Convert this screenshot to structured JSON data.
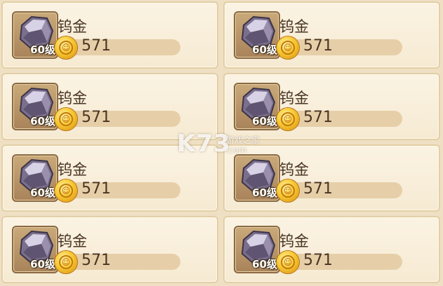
{
  "items": [
    {
      "name": "钨金",
      "level": "60级",
      "amount": "571",
      "icon": "ore-stone-icon"
    },
    {
      "name": "钨金",
      "level": "60级",
      "amount": "571",
      "icon": "ore-stone-icon"
    },
    {
      "name": "钨金",
      "level": "60级",
      "amount": "571",
      "icon": "ore-stone-icon"
    },
    {
      "name": "钨金",
      "level": "60级",
      "amount": "571",
      "icon": "ore-stone-icon"
    },
    {
      "name": "钨金",
      "level": "60级",
      "amount": "571",
      "icon": "ore-stone-icon"
    },
    {
      "name": "钨金",
      "level": "60级",
      "amount": "571",
      "icon": "ore-stone-icon"
    },
    {
      "name": "钨金",
      "level": "60级",
      "amount": "571",
      "icon": "ore-stone-icon"
    },
    {
      "name": "钨金",
      "level": "60级",
      "amount": "571",
      "icon": "ore-stone-icon"
    }
  ],
  "currency_icon": "gold-coin-icon",
  "watermark": {
    "logo": "K73",
    "sub": "游戏之家",
    "domain": ".com"
  },
  "colors": {
    "card_bg": "#f8eedb",
    "card_border": "#e2cfa6",
    "bar_bg": "#e6cfa8",
    "text": "#4a3422"
  }
}
